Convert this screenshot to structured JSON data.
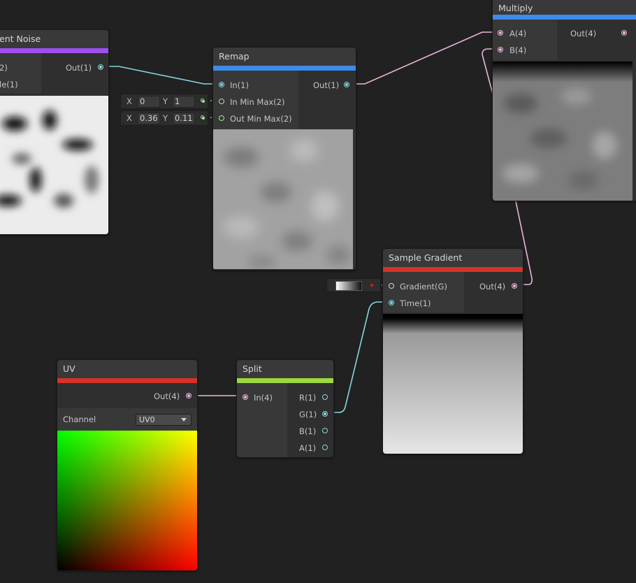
{
  "nodes": {
    "gradient_noise": {
      "title": "ent Noise",
      "accent": "#9f4ff0",
      "inputs": [
        "2)",
        "le(1)"
      ],
      "output": "Out(1)"
    },
    "remap": {
      "title": "Remap",
      "accent": "#3d8ce9",
      "inputs": [
        "In(1)",
        "In Min Max(2)",
        "Out Min Max(2)"
      ],
      "output": "Out(1)",
      "in_min_max": {
        "x_label": "X",
        "x": "0",
        "y_label": "Y",
        "y": "1"
      },
      "out_min_max": {
        "x_label": "X",
        "x": "0.36",
        "y_label": "Y",
        "y": "0.11"
      }
    },
    "multiply": {
      "title": "Multiply",
      "accent": "#3d8ce9",
      "inputs": [
        "A(4)",
        "B(4)"
      ],
      "output": "Out(4)"
    },
    "sample_gradient": {
      "title": "Sample Gradient",
      "accent": "#d63228",
      "inputs": [
        "Gradient(G)",
        "Time(1)"
      ],
      "output": "Out(4)"
    },
    "uv": {
      "title": "UV",
      "accent": "#d63228",
      "output": "Out(4)",
      "channel_label": "Channel",
      "channel_value": "UV0"
    },
    "split": {
      "title": "Split",
      "accent": "#9cd83e",
      "input": "In(4)",
      "outputs": [
        "R(1)",
        "G(1)",
        "B(1)",
        "A(1)"
      ]
    }
  },
  "colors": {
    "wire_float": "#85d6e0",
    "wire_vector": "#ecb5dc",
    "background": "#212121"
  }
}
